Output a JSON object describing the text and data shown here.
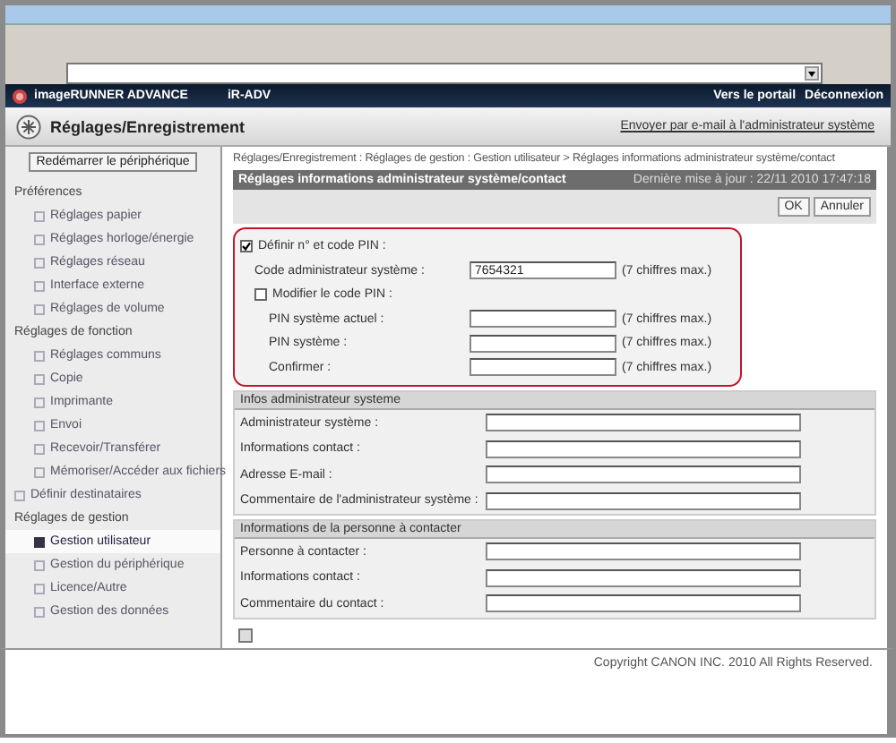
{
  "header": {
    "product": "imageRUNNER ADVANCE",
    "model": "iR-ADV",
    "links": [
      "Vers le portail",
      "Déconnexion"
    ]
  },
  "page": {
    "title": "Réglages/Enregistrement",
    "email_link": "Envoyer par e-mail à l'administrateur système"
  },
  "sidebar": {
    "restart_button": "Redémarrer le périphérique",
    "items": [
      {
        "label": "Préférences",
        "kind": "heading",
        "children": [
          {
            "label": "Réglages papier",
            "selected": false
          },
          {
            "label": "Réglages horloge/énergie",
            "selected": false
          },
          {
            "label": "Réglages réseau",
            "selected": false
          },
          {
            "label": "Interface externe",
            "selected": false
          },
          {
            "label": "Réglages de volume",
            "selected": false
          }
        ]
      },
      {
        "label": "Réglages de fonction",
        "kind": "heading",
        "children": [
          {
            "label": "Réglages communs",
            "selected": false
          },
          {
            "label": "Copie",
            "selected": false
          },
          {
            "label": "Imprimante",
            "selected": false
          },
          {
            "label": "Envoi",
            "selected": false
          },
          {
            "label": "Recevoir/Transférer",
            "selected": false
          },
          {
            "label": "Mémoriser/Accéder aux fichiers",
            "selected": false
          }
        ]
      },
      {
        "label": "Définir destinataires",
        "kind": "link",
        "selected": false
      },
      {
        "label": "Réglages de gestion",
        "kind": "heading",
        "children": [
          {
            "label": "Gestion utilisateur",
            "selected": true
          },
          {
            "label": "Gestion du périphérique",
            "selected": false
          },
          {
            "label": "Licence/Autre",
            "selected": false
          },
          {
            "label": "Gestion des données",
            "selected": false
          }
        ]
      }
    ]
  },
  "breadcrumb": "Réglages/Enregistrement : Réglages de gestion : Gestion utilisateur > Réglages informations administrateur système/contact",
  "form": {
    "title": "Réglages informations administrateur système/contact",
    "last_update": "Dernière mise à jour : 22/11 2010 17:47:18",
    "buttons": [
      "OK",
      "Annuler"
    ],
    "pin": {
      "set_checkbox": {
        "label": "Définir n° et code PIN :",
        "checked": true
      },
      "admin_code": {
        "label": "Code administrateur système :",
        "value": "7654321",
        "hint": "(7 chiffres max.)"
      },
      "modify_checkbox": {
        "label": "Modifier le code PIN :",
        "checked": false
      },
      "fields": [
        {
          "label": "PIN système actuel :",
          "hint": "(7 chiffres max.)"
        },
        {
          "label": "PIN système :",
          "hint": "(7 chiffres max.)"
        },
        {
          "label": "Confirmer :",
          "hint": "(7 chiffres max.)"
        }
      ]
    },
    "sections": [
      {
        "title": "Infos administrateur systeme",
        "fields": [
          "Administrateur système :",
          "Informations contact :",
          "Adresse E-mail :",
          "Commentaire de l'administrateur système :"
        ]
      },
      {
        "title": "Informations de la personne à contacter",
        "fields": [
          "Personne à contacter :",
          "Informations contact :",
          "Commentaire du contact :"
        ]
      }
    ]
  },
  "footer": {
    "copyright": "Copyright CANON INC. 2010 All Rights Reserved."
  }
}
